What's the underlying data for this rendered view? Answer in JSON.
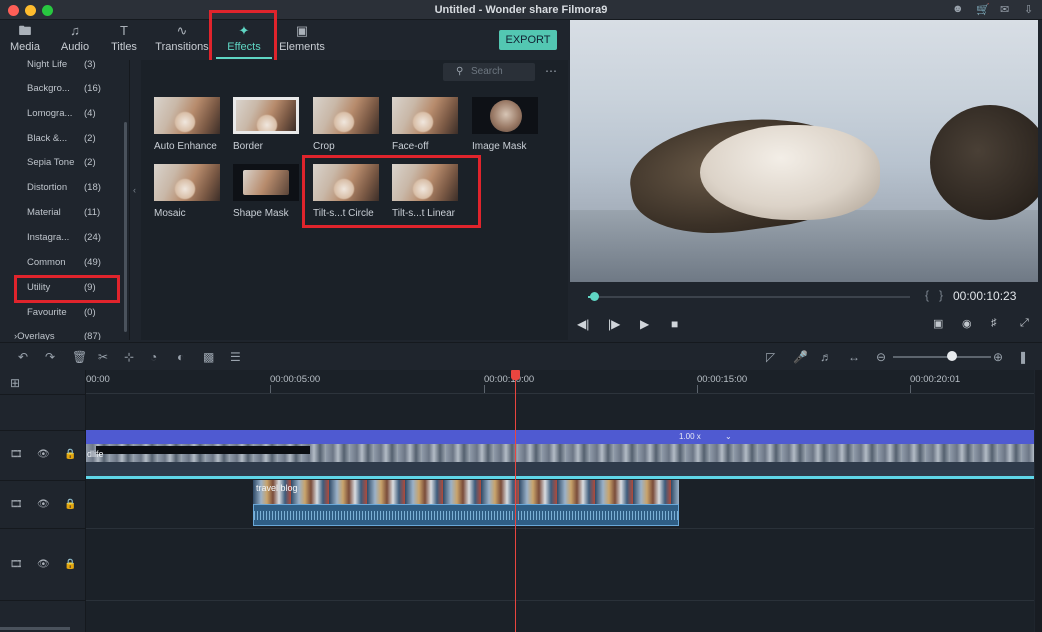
{
  "window": {
    "title": "Untitled - Wonder share Filmora9",
    "traffic_lights": [
      "#ff5f57",
      "#febc2e",
      "#28c840"
    ],
    "right_icons": [
      "user-icon",
      "cart-icon",
      "mail-icon",
      "download-icon"
    ]
  },
  "tabs": [
    {
      "label": "Media",
      "icon": "folder-icon"
    },
    {
      "label": "Audio",
      "icon": "music-note-icon"
    },
    {
      "label": "Titles",
      "icon": "title-t-icon"
    },
    {
      "label": "Transitions",
      "icon": "transition-icon"
    },
    {
      "label": "Effects",
      "icon": "effects-sparkle-icon",
      "active": true
    },
    {
      "label": "Elements",
      "icon": "image-icon"
    }
  ],
  "export_label": "EXPORT",
  "accent": "#5fd6c4",
  "highlight": "#e0242c",
  "categories": [
    {
      "name": "Night Life",
      "count": "(3)"
    },
    {
      "name": "Backgro...",
      "count": "(16)"
    },
    {
      "name": "Lomogra...",
      "count": "(4)"
    },
    {
      "name": "Black &...",
      "count": "(2)"
    },
    {
      "name": "Sepia Tone",
      "count": "(2)"
    },
    {
      "name": "Distortion",
      "count": "(18)"
    },
    {
      "name": "Material",
      "count": "(11)"
    },
    {
      "name": "Instagra...",
      "count": "(24)"
    },
    {
      "name": "Common",
      "count": "(49)"
    },
    {
      "name": "Utility",
      "count": "(9)",
      "selected": true
    },
    {
      "name": "Favourite",
      "count": "(0)"
    },
    {
      "name": "Overlays",
      "count": "(87)"
    }
  ],
  "search": {
    "placeholder": "Search"
  },
  "effects": [
    {
      "name": "Auto Enhance"
    },
    {
      "name": "Border"
    },
    {
      "name": "Crop"
    },
    {
      "name": "Face-off"
    },
    {
      "name": "Image Mask"
    },
    {
      "name": "Mosaic"
    },
    {
      "name": "Shape Mask"
    },
    {
      "name": "Tilt-s...t Circle"
    },
    {
      "name": "Tilt-s...t Linear"
    }
  ],
  "player": {
    "timecode": "00:00:10:23",
    "progress": 0.02,
    "zoom_level": 0.6
  },
  "timeline": {
    "ruler": [
      "00:00",
      "00:00:05:00",
      "00:00:10:00",
      "00:00:15:00",
      "00:00:20:01"
    ],
    "speed_label": "1.00 x",
    "video_clip_name": "dlife",
    "clip2_name": "travel blog"
  }
}
